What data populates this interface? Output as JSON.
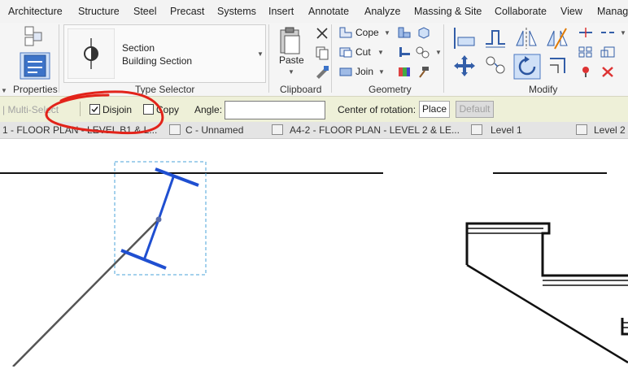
{
  "ribbon_tabs": [
    "Architecture",
    "Structure",
    "Steel",
    "Precast",
    "Systems",
    "Insert",
    "Annotate",
    "Analyze",
    "Massing & Site",
    "Collaborate",
    "View",
    "Manag"
  ],
  "type_selector": {
    "family": "Section",
    "type": "Building Section"
  },
  "panels": {
    "properties": "Properties",
    "type_selector": "Type Selector",
    "clipboard": "Clipboard",
    "geometry": "Geometry",
    "modify": "Modify"
  },
  "tools": {
    "paste": "Paste",
    "cope": "Cope",
    "cut": "Cut",
    "join": "Join"
  },
  "options_bar": {
    "multi_select": "| Multi-Select",
    "disjoin": "Disjoin",
    "copy": "Copy",
    "angle_label": "Angle:",
    "angle_value": "",
    "center_label": "Center of rotation:",
    "place": "Place",
    "default": "Default"
  },
  "view_tabs": [
    "1 - FLOOR PLAN - LEVEL B1 & L...",
    "C - Unnamed",
    "A4-2 - FLOOR PLAN - LEVEL 2 & LE...",
    "Level 1",
    "Level 2"
  ],
  "colors": {
    "selection": "#1f4fd1",
    "annotation": "#e2231a",
    "options_bar": "#eef0d8"
  }
}
